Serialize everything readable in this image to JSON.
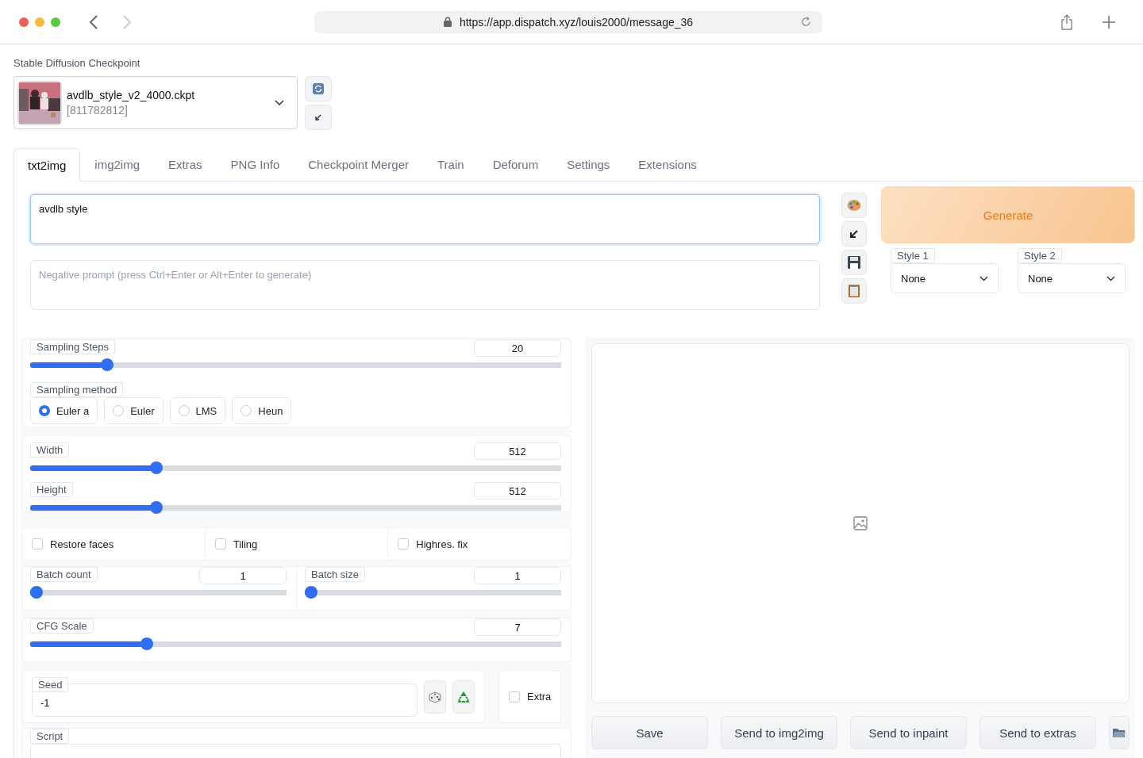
{
  "browser": {
    "url": "https://app.dispatch.xyz/louis2000/message_36"
  },
  "checkpoint": {
    "label": "Stable Diffusion Checkpoint",
    "name": "avdlb_style_v2_4000.ckpt",
    "hash": "[811782812]"
  },
  "tabs": [
    {
      "label": "txt2img",
      "selected": true
    },
    {
      "label": "img2img",
      "selected": false
    },
    {
      "label": "Extras",
      "selected": false
    },
    {
      "label": "PNG Info",
      "selected": false
    },
    {
      "label": "Checkpoint Merger",
      "selected": false
    },
    {
      "label": "Train",
      "selected": false
    },
    {
      "label": "Deforum",
      "selected": false
    },
    {
      "label": "Settings",
      "selected": false
    },
    {
      "label": "Extensions",
      "selected": false
    }
  ],
  "prompt": {
    "value": "avdlb style"
  },
  "negative_prompt": {
    "placeholder": "Negative prompt (press Ctrl+Enter or Alt+Enter to generate)"
  },
  "generate": {
    "label": "Generate"
  },
  "styles": [
    {
      "label": "Style 1",
      "value": "None"
    },
    {
      "label": "Style 2",
      "value": "None"
    }
  ],
  "sampling_steps": {
    "label": "Sampling Steps",
    "value": "20",
    "level": 0.137
  },
  "sampling_method": {
    "label": "Sampling method",
    "options": [
      {
        "label": "Euler a",
        "selected": true
      },
      {
        "label": "Euler",
        "selected": false
      },
      {
        "label": "LMS",
        "selected": false
      },
      {
        "label": "Heun",
        "selected": false
      }
    ]
  },
  "width": {
    "label": "Width",
    "value": "512",
    "level": 0.232
  },
  "height": {
    "label": "Height",
    "value": "512",
    "level": 0.232
  },
  "options": [
    {
      "label": "Restore faces",
      "checked": false
    },
    {
      "label": "Tiling",
      "checked": false
    },
    {
      "label": "Highres. fix",
      "checked": false
    }
  ],
  "batch_count": {
    "label": "Batch count",
    "value": "1",
    "level": 0
  },
  "batch_size": {
    "label": "Batch size",
    "value": "1",
    "level": 0
  },
  "cfg_scale": {
    "label": "CFG Scale",
    "value": "7",
    "level": 0.213
  },
  "seed": {
    "label": "Seed",
    "value": "-1"
  },
  "extra": {
    "label": "Extra",
    "checked": false
  },
  "script": {
    "label": "Script"
  },
  "output_buttons": [
    "Save",
    "Send to img2img",
    "Send to inpaint",
    "Send to extras"
  ]
}
